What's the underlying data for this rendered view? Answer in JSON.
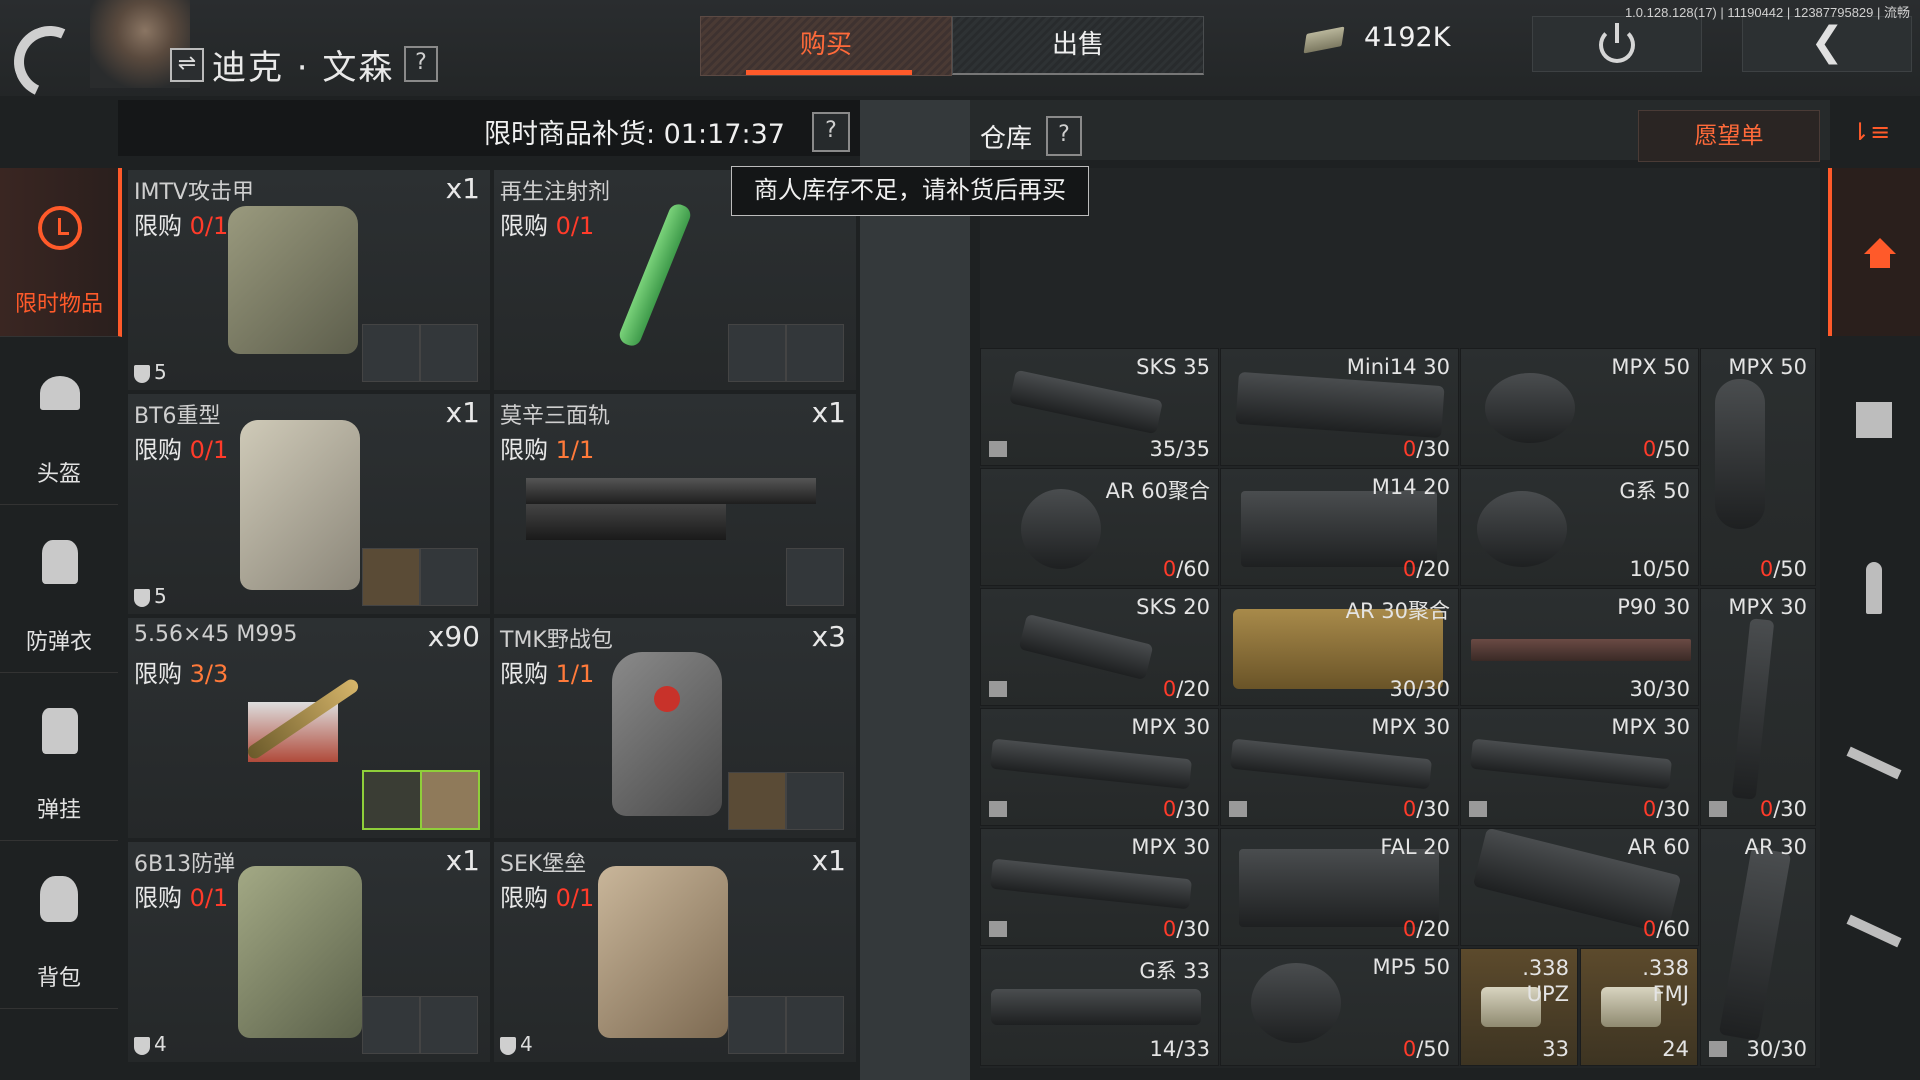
{
  "header": {
    "trader_name": "迪克 · 文森",
    "help": "?",
    "tabs": {
      "buy": "购买",
      "sell": "出售"
    },
    "money": "4192K",
    "version": "1.0.128.128(17) | 11190442 | 12387795829 | 流畅",
    "back_glyph": "❮"
  },
  "sidebar": {
    "items": [
      {
        "label": "限时物品",
        "icon": "clock-icon"
      },
      {
        "label": "头盔",
        "icon": "helmet-icon"
      },
      {
        "label": "防弹衣",
        "icon": "vest-icon"
      },
      {
        "label": "弹挂",
        "icon": "chest-rig-icon"
      },
      {
        "label": "背包",
        "icon": "backpack-icon"
      }
    ]
  },
  "shop": {
    "restock_label": "限时商品补货: 01:17:37",
    "limit_prefix": "限购",
    "cards": [
      {
        "name": "IMTV攻击甲",
        "limit": "0/1",
        "qty": "x1",
        "armor": "5"
      },
      {
        "name": "再生注射剂",
        "limit": "0/1",
        "qty": "",
        "armor": ""
      },
      {
        "name": "BT6重型",
        "limit": "0/1",
        "qty": "x1",
        "armor": "5"
      },
      {
        "name": "莫辛三面轨",
        "limit": "1/1",
        "qty": "x1",
        "armor": ""
      },
      {
        "name": "5.56×45 M995",
        "limit": "3/3",
        "qty": "x90",
        "armor": ""
      },
      {
        "name": "TMK野战包",
        "limit": "1/1",
        "qty": "x3",
        "armor": ""
      },
      {
        "name": "6B13防弹",
        "limit": "0/1",
        "qty": "x1",
        "armor": "4"
      },
      {
        "name": "SEK堡垒",
        "limit": "0/1",
        "qty": "x1",
        "armor": "4"
      }
    ]
  },
  "tooltip": "商人库存不足，请补货后再买",
  "warehouse": {
    "title": "仓库",
    "wishlist": "愿望单",
    "cells": [
      {
        "name": "SKS 35",
        "count_red": "",
        "count": "35/35"
      },
      {
        "name": "Mini14 30",
        "count_red": "0",
        "count": "/30"
      },
      {
        "name": "MPX 50",
        "count_red": "0",
        "count": "/50"
      },
      {
        "name": "MPX 50",
        "count_red": "0",
        "count": "/50"
      },
      {
        "name": "AR 60聚合",
        "count_red": "0",
        "count": "/60"
      },
      {
        "name": "M14 20",
        "count_red": "0",
        "count": "/20"
      },
      {
        "name": "G系 50",
        "count_red": "",
        "count": "10/50"
      },
      {
        "name": "SKS 20",
        "count_red": "0",
        "count": "/20"
      },
      {
        "name": "AR 30聚合",
        "count_red": "",
        "count": "30/30"
      },
      {
        "name": "P90 30",
        "count_red": "",
        "count": "30/30"
      },
      {
        "name": "MPX 30",
        "count_red": "0",
        "count": "/30"
      },
      {
        "name": "MPX 30",
        "count_red": "0",
        "count": "/30"
      },
      {
        "name": "MPX 30",
        "count_red": "0",
        "count": "/30"
      },
      {
        "name": "MPX 30",
        "count_red": "0",
        "count": "/30"
      },
      {
        "name": "MPX 30",
        "count_red": "0",
        "count": "/30"
      },
      {
        "name": "FAL 20",
        "count_red": "0",
        "count": "/20"
      },
      {
        "name": "AR 60",
        "count_red": "0",
        "count": "/60"
      },
      {
        "name": "AR 30",
        "count_red": "",
        "count": "30/30"
      },
      {
        "name": "G系 33",
        "count_red": "",
        "count": "14/33"
      },
      {
        "name": "MP5 50",
        "count_red": "0",
        "count": "/50"
      },
      {
        "name": ".338 UPZ",
        "count_red": "",
        "count": "33"
      },
      {
        "name": ".338 FMJ",
        "count_red": "",
        "count": "24"
      }
    ]
  }
}
